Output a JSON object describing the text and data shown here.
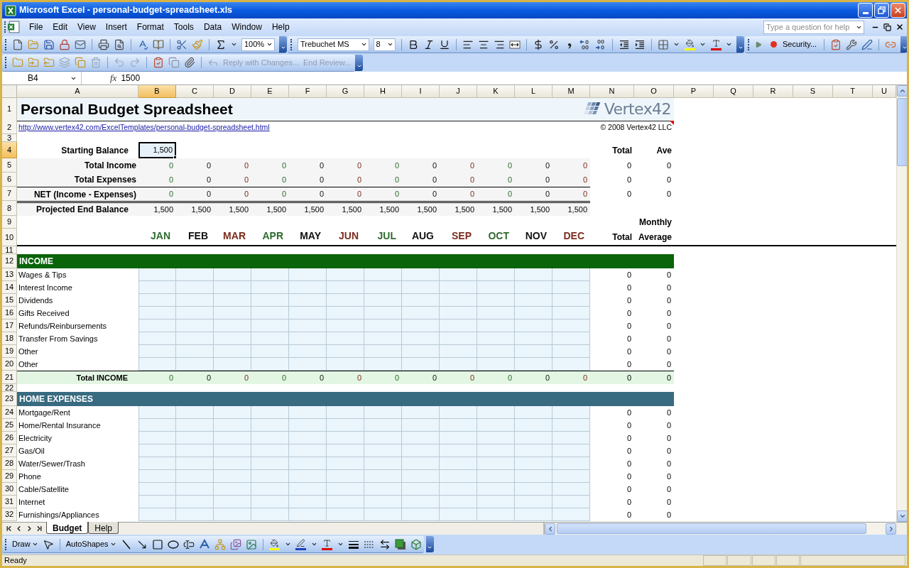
{
  "window": {
    "title": "Microsoft Excel - personal-budget-spreadsheet.xls"
  },
  "menu": [
    "File",
    "Edit",
    "View",
    "Insert",
    "Format",
    "Tools",
    "Data",
    "Window",
    "Help"
  ],
  "help_box": {
    "placeholder": "Type a question for help"
  },
  "standard_toolbar": {
    "zoom": "100%"
  },
  "formatting_toolbar": {
    "font": "Trebuchet MS",
    "size": "8"
  },
  "macro_toolbar": {
    "security": "Security..."
  },
  "reviewing_toolbar": {
    "buttons": [
      {
        "label": "Reply with Changes...",
        "disabled": true
      },
      {
        "label": "End Review...",
        "disabled": true
      }
    ]
  },
  "formula_bar": {
    "name_box": "B4",
    "function_label": "fx",
    "value": "1500"
  },
  "columns": [
    {
      "label": "A",
      "selected": false
    },
    {
      "label": "B",
      "selected": true
    },
    {
      "label": "C",
      "selected": false
    },
    {
      "label": "D",
      "selected": false
    },
    {
      "label": "E",
      "selected": false
    },
    {
      "label": "F",
      "selected": false
    },
    {
      "label": "G",
      "selected": false
    },
    {
      "label": "H",
      "selected": false
    },
    {
      "label": "I",
      "selected": false
    },
    {
      "label": "J",
      "selected": false
    },
    {
      "label": "K",
      "selected": false
    },
    {
      "label": "L",
      "selected": false
    },
    {
      "label": "M",
      "selected": false
    },
    {
      "label": "N",
      "selected": false
    },
    {
      "label": "O",
      "selected": false
    },
    {
      "label": "P",
      "selected": false
    },
    {
      "label": "Q",
      "selected": false
    },
    {
      "label": "R",
      "selected": false
    },
    {
      "label": "S",
      "selected": false
    },
    {
      "label": "T",
      "selected": false
    },
    {
      "label": "U",
      "selected": false
    }
  ],
  "rows": [
    {
      "number": "1",
      "selected": false,
      "kind": "title",
      "title": "Personal Budget Spreadsheet",
      "logo": "Vertex42"
    },
    {
      "number": "2",
      "selected": false,
      "kind": "link",
      "link": "http://www.vertex42.com/ExcelTemplates/personal-budget-spreadsheet.html",
      "copyright": "© 2008 Vertex42 LLC",
      "comment": true
    },
    {
      "number": "3",
      "selected": false,
      "kind": "spacer"
    },
    {
      "number": "4",
      "selected": true,
      "kind": "balance",
      "label": "Starting Balance",
      "value": "1,500",
      "total": "Total",
      "average": "Ave"
    },
    {
      "number": "5",
      "selected": false,
      "kind": "summary",
      "label": "Total Income",
      "values": [
        "0",
        "0",
        "0",
        "0",
        "0",
        "0",
        "0",
        "0",
        "0",
        "0",
        "0",
        "0"
      ],
      "total": "0",
      "average": "0"
    },
    {
      "number": "6",
      "selected": false,
      "kind": "summary",
      "label": "Total Expenses",
      "values": [
        "0",
        "0",
        "0",
        "0",
        "0",
        "0",
        "0",
        "0",
        "0",
        "0",
        "0",
        "0"
      ],
      "total": "0",
      "average": "0"
    },
    {
      "number": "7",
      "selected": false,
      "kind": "net",
      "label": "NET (Income - Expenses)",
      "values": [
        "0",
        "0",
        "0",
        "0",
        "0",
        "0",
        "0",
        "0",
        "0",
        "0",
        "0",
        "0"
      ],
      "total": "0",
      "average": "0"
    },
    {
      "number": "8",
      "selected": false,
      "kind": "projected",
      "label": "Projected End Balance",
      "values": [
        "1,500",
        "1,500",
        "1,500",
        "1,500",
        "1,500",
        "1,500",
        "1,500",
        "1,500",
        "1,500",
        "1,500",
        "1,500",
        "1,500"
      ]
    },
    {
      "number": "9",
      "selected": false,
      "kind": "heading",
      "average": "Monthly"
    },
    {
      "number": "10",
      "selected": false,
      "kind": "months",
      "months": [
        {
          "label": "JAN",
          "color": "#2e6b2e"
        },
        {
          "label": "FEB",
          "color": "#111111"
        },
        {
          "label": "MAR",
          "color": "#7b2d1e"
        },
        {
          "label": "APR",
          "color": "#2e6b2e"
        },
        {
          "label": "MAY",
          "color": "#111111"
        },
        {
          "label": "JUN",
          "color": "#7b2d1e"
        },
        {
          "label": "JUL",
          "color": "#2e6b2e"
        },
        {
          "label": "AUG",
          "color": "#111111"
        },
        {
          "label": "SEP",
          "color": "#7b2d1e"
        },
        {
          "label": "OCT",
          "color": "#2e6b2e"
        },
        {
          "label": "NOV",
          "color": "#111111"
        },
        {
          "label": "DEC",
          "color": "#7b2d1e"
        }
      ],
      "total": "Total",
      "average": "Average"
    },
    {
      "number": "11",
      "selected": false,
      "kind": "spacer"
    },
    {
      "number": "12",
      "selected": false,
      "kind": "section",
      "title": "INCOME",
      "color": "#0a640a"
    },
    {
      "number": "13",
      "selected": false,
      "kind": "item",
      "label": "Wages & Tips",
      "total": "0",
      "average": "0"
    },
    {
      "number": "14",
      "selected": false,
      "kind": "item",
      "label": "Interest Income",
      "total": "0",
      "average": "0"
    },
    {
      "number": "15",
      "selected": false,
      "kind": "item",
      "label": "Dividends",
      "total": "0",
      "average": "0"
    },
    {
      "number": "16",
      "selected": false,
      "kind": "item",
      "label": "Gifts Received",
      "total": "0",
      "average": "0"
    },
    {
      "number": "17",
      "selected": false,
      "kind": "item",
      "label": "Refunds/Reinbursements",
      "total": "0",
      "average": "0"
    },
    {
      "number": "18",
      "selected": false,
      "kind": "item",
      "label": "Transfer From Savings",
      "total": "0",
      "average": "0"
    },
    {
      "number": "19",
      "selected": false,
      "kind": "item",
      "label": "Other",
      "total": "0",
      "average": "0"
    },
    {
      "number": "20",
      "selected": false,
      "kind": "item",
      "label": "Other",
      "total": "0",
      "average": "0"
    },
    {
      "number": "21",
      "selected": false,
      "kind": "total",
      "label": "Total INCOME",
      "values": [
        "0",
        "0",
        "0",
        "0",
        "0",
        "0",
        "0",
        "0",
        "0",
        "0",
        "0",
        "0"
      ],
      "total": "0",
      "average": "0"
    },
    {
      "number": "22",
      "selected": false,
      "kind": "spacer"
    },
    {
      "number": "23",
      "selected": false,
      "kind": "section",
      "title": "HOME EXPENSES",
      "color": "#386a80"
    },
    {
      "number": "24",
      "selected": false,
      "kind": "item",
      "label": "Mortgage/Rent",
      "total": "0",
      "average": "0"
    },
    {
      "number": "25",
      "selected": false,
      "kind": "item",
      "label": "Home/Rental Insurance",
      "total": "0",
      "average": "0"
    },
    {
      "number": "26",
      "selected": false,
      "kind": "item",
      "label": "Electricity",
      "total": "0",
      "average": "0"
    },
    {
      "number": "27",
      "selected": false,
      "kind": "item",
      "label": "Gas/Oil",
      "total": "0",
      "average": "0"
    },
    {
      "number": "28",
      "selected": false,
      "kind": "item",
      "label": "Water/Sewer/Trash",
      "total": "0",
      "average": "0"
    },
    {
      "number": "29",
      "selected": false,
      "kind": "item",
      "label": "Phone",
      "total": "0",
      "average": "0"
    },
    {
      "number": "30",
      "selected": false,
      "kind": "item",
      "label": "Cable/Satellite",
      "total": "0",
      "average": "0"
    },
    {
      "number": "31",
      "selected": false,
      "kind": "item",
      "label": "Internet",
      "total": "0",
      "average": "0"
    },
    {
      "number": "32",
      "selected": false,
      "kind": "item",
      "label": "Furnishings/Appliances",
      "total": "0",
      "average": "0"
    }
  ],
  "sheet_tabs": [
    {
      "label": "Budget",
      "selected": true
    },
    {
      "label": "Help",
      "selected": false
    }
  ],
  "drawing_toolbar": {
    "draw": "Draw",
    "autoshapes": "AutoShapes"
  },
  "status_bar": {
    "text": "Ready"
  }
}
